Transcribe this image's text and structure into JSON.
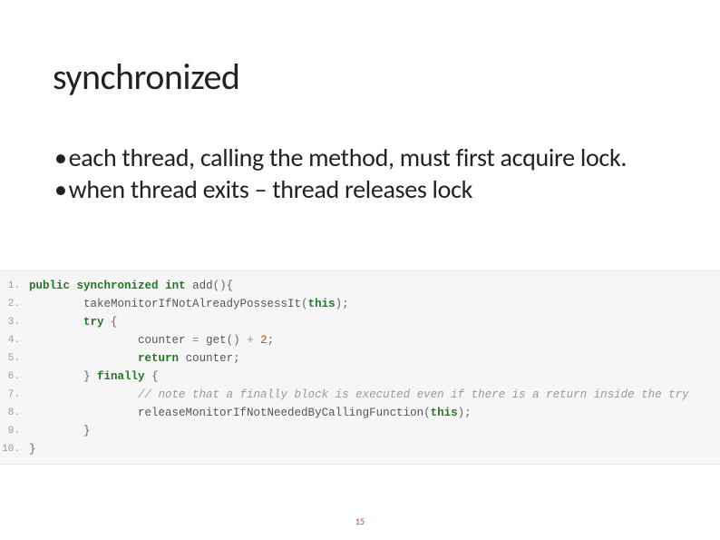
{
  "title": "synchronized",
  "bullets": [
    "each thread, calling the method, must first acquire lock.",
    "when thread exits – thread releases lock"
  ],
  "code": {
    "lines": [
      {
        "n": "1.",
        "tokens": [
          [
            "kw",
            "public"
          ],
          [
            "sp",
            " "
          ],
          [
            "kw",
            "synchronized"
          ],
          [
            "sp",
            " "
          ],
          [
            "type",
            "int"
          ],
          [
            "sp",
            " "
          ],
          [
            "fn",
            "add"
          ],
          [
            "punc",
            "()"
          ],
          [
            "punc",
            "{"
          ]
        ]
      },
      {
        "n": "2.",
        "tokens": [
          [
            "sp",
            "        "
          ],
          [
            "fn",
            "takeMonitorIfNotAlreadyPossessIt"
          ],
          [
            "punc",
            "("
          ],
          [
            "this",
            "this"
          ],
          [
            "punc",
            ")"
          ],
          [
            "punc",
            ";"
          ]
        ]
      },
      {
        "n": "3.",
        "tokens": [
          [
            "sp",
            "        "
          ],
          [
            "kw",
            "try"
          ],
          [
            "sp",
            " "
          ],
          [
            "punc",
            "{"
          ]
        ]
      },
      {
        "n": "4.",
        "tokens": [
          [
            "sp",
            "                "
          ],
          [
            "id",
            "counter"
          ],
          [
            "sp",
            " "
          ],
          [
            "op",
            "="
          ],
          [
            "sp",
            " "
          ],
          [
            "fn",
            "get"
          ],
          [
            "punc",
            "()"
          ],
          [
            "sp",
            " "
          ],
          [
            "op",
            "+"
          ],
          [
            "sp",
            " "
          ],
          [
            "num",
            "2"
          ],
          [
            "punc",
            ";"
          ]
        ]
      },
      {
        "n": "5.",
        "tokens": [
          [
            "sp",
            "                "
          ],
          [
            "kw",
            "return"
          ],
          [
            "sp",
            " "
          ],
          [
            "id",
            "counter"
          ],
          [
            "punc",
            ";"
          ]
        ]
      },
      {
        "n": "6.",
        "tokens": [
          [
            "sp",
            "        "
          ],
          [
            "punc",
            "}"
          ],
          [
            "sp",
            " "
          ],
          [
            "kw",
            "finally"
          ],
          [
            "sp",
            " "
          ],
          [
            "punc",
            "{"
          ]
        ]
      },
      {
        "n": "7.",
        "tokens": [
          [
            "sp",
            "                "
          ],
          [
            "comm",
            "// note that a finally block is executed even if there is a return inside the try"
          ]
        ]
      },
      {
        "n": "8.",
        "tokens": [
          [
            "sp",
            "                "
          ],
          [
            "fn",
            "releaseMonitorIfNotNeededByCallingFunction"
          ],
          [
            "punc",
            "("
          ],
          [
            "this",
            "this"
          ],
          [
            "punc",
            ")"
          ],
          [
            "punc",
            ";"
          ]
        ]
      },
      {
        "n": "9.",
        "tokens": [
          [
            "sp",
            "        "
          ],
          [
            "punc",
            "}"
          ]
        ]
      },
      {
        "n": "10.",
        "tokens": [
          [
            "punc",
            "}"
          ]
        ]
      }
    ]
  },
  "page_number": "15"
}
